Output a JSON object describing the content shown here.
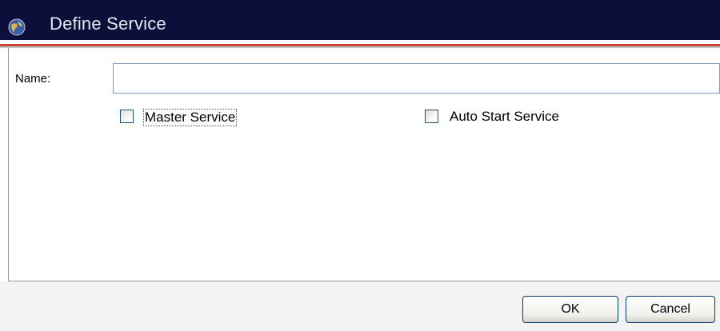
{
  "window": {
    "title": "Define Service",
    "icon": "globe-service-icon"
  },
  "form": {
    "name_label": "Name:",
    "name_value": "",
    "name_placeholder": "",
    "master_service_label": "Master Service",
    "master_service_checked": false,
    "auto_start_label": "Auto Start Service",
    "auto_start_checked": false
  },
  "buttons": {
    "ok_label": "OK",
    "cancel_label": "Cancel"
  },
  "colors": {
    "titlebar": "#0b0f3a",
    "accent_line": "#c8453a",
    "button_border": "#003c74"
  }
}
